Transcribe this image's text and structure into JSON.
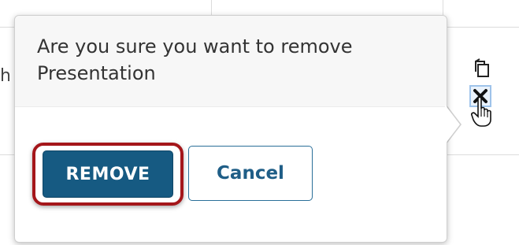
{
  "background_row": {
    "clipped_text": "h"
  },
  "row_actions": {
    "copy_icon": "copy-icon",
    "remove_icon": "remove-x-icon",
    "cursor_icon": "hand-pointer-cursor-icon"
  },
  "confirm_popover": {
    "message": "Are you sure you want to remove Presentation",
    "remove_label": "REMOVE",
    "cancel_label": "Cancel"
  },
  "colors": {
    "primary_button": "#165a82",
    "highlight_border": "#a4161a",
    "cancel_text": "#1f5e87",
    "popover_header_bg": "#f7f7f7"
  }
}
